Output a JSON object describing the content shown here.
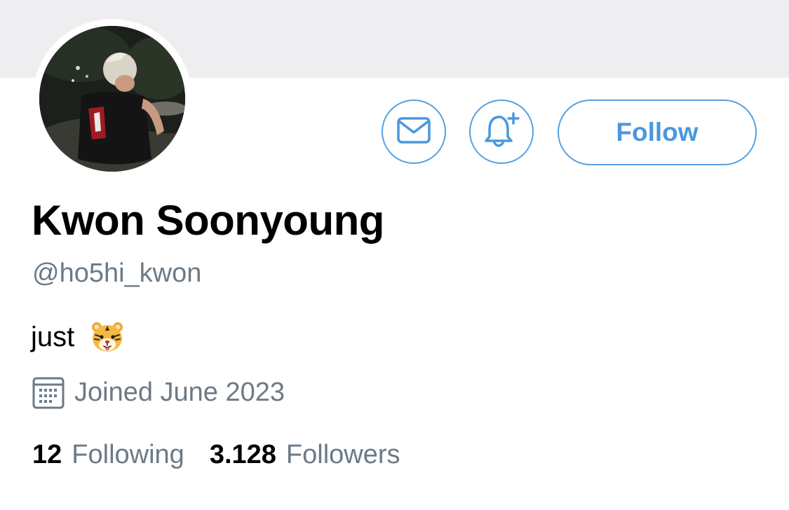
{
  "profile": {
    "display_name": "Kwon Soonyoung",
    "handle": "@ho5hi_kwon",
    "bio_text": "just",
    "bio_emoji": "tiger-face-emoji",
    "joined": "Joined June 2023",
    "avatar": "profile-photo"
  },
  "actions": {
    "message_icon": "envelope-icon",
    "notify_icon": "bell-plus-icon",
    "follow_label": "Follow"
  },
  "stats": {
    "following_count": "12",
    "following_label": "Following",
    "followers_count": "3.128",
    "followers_label": "Followers"
  },
  "colors": {
    "accent": "#4a97df",
    "border_accent": "#55a0e0",
    "secondary_text": "#6b7a87",
    "banner": "#eeeef0"
  }
}
